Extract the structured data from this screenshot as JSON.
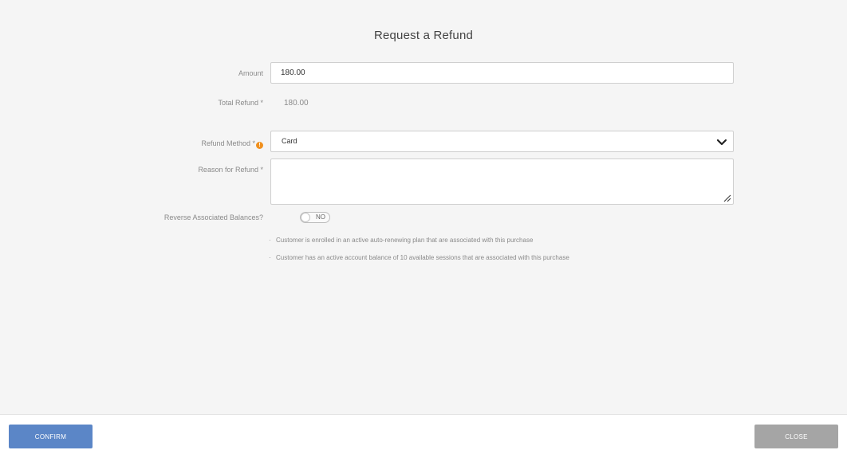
{
  "dialog": {
    "title": "Request a Refund"
  },
  "form": {
    "amount_label": "Amount",
    "amount_value": "180.00",
    "total_refund_label": "Total Refund *",
    "total_refund_value": "180.00",
    "refund_method_label": "Refund Method *",
    "refund_method_value": "Card",
    "reason_label": "Reason for Refund *",
    "reason_value": "",
    "reverse_label": "Reverse Associated Balances?",
    "reverse_toggle_text": "NO"
  },
  "notes": [
    "Customer is enrolled in an active auto-renewing plan that are associated with this purchase",
    "Customer has an active account balance of 10 available sessions that are associated with this purchase"
  ],
  "footer": {
    "confirm_label": "CONFIRM",
    "close_label": "CLOSE"
  },
  "icons": {
    "info": "info-icon",
    "dropdown": "chevron-down-icon",
    "resize": "resize-handle-icon"
  },
  "colors": {
    "confirm": "#5b86c7",
    "close": "#a5a5a5",
    "info": "#f0901e"
  }
}
